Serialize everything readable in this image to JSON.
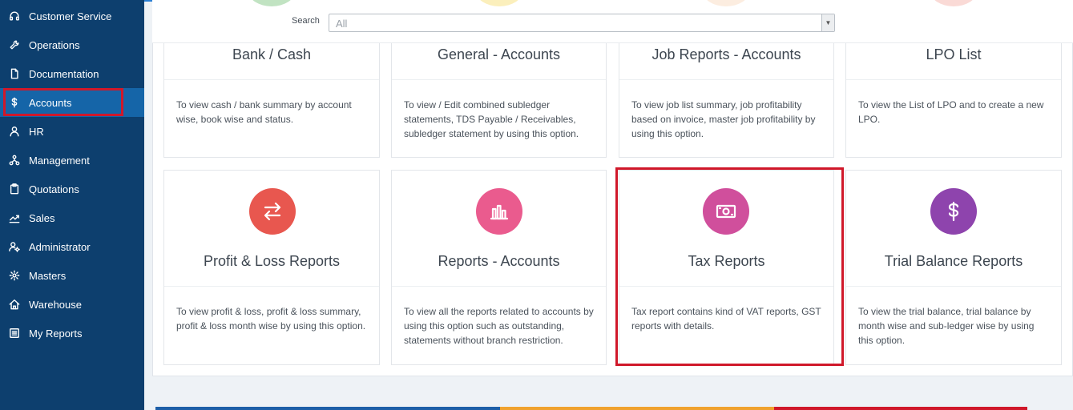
{
  "sidebar": {
    "items": [
      {
        "label": "Customer Service",
        "icon": "headset-icon"
      },
      {
        "label": "Operations",
        "icon": "wrench-icon"
      },
      {
        "label": "Documentation",
        "icon": "document-icon"
      },
      {
        "label": "Accounts",
        "icon": "dollar-icon",
        "active": true
      },
      {
        "label": "HR",
        "icon": "user-icon"
      },
      {
        "label": "Management",
        "icon": "hierarchy-icon"
      },
      {
        "label": "Quotations",
        "icon": "clipboard-icon"
      },
      {
        "label": "Sales",
        "icon": "chart-line-icon"
      },
      {
        "label": "Administrator",
        "icon": "user-gear-icon"
      },
      {
        "label": "Masters",
        "icon": "gear-icon"
      },
      {
        "label": "Warehouse",
        "icon": "home-icon"
      },
      {
        "label": "My Reports",
        "icon": "report-list-icon"
      }
    ]
  },
  "search": {
    "label": "Search",
    "selected": "All"
  },
  "cards": [
    {
      "title": "Bank / Cash",
      "desc": "To view cash / bank summary by account wise, book wise and status."
    },
    {
      "title": "General - Accounts",
      "desc": "To view / Edit combined subledger statements, TDS Payable / Receivables, subledger statement by using this option."
    },
    {
      "title": "Job Reports - Accounts",
      "desc": "To view job list summary, job profitability based on invoice, master job profitability by using this option."
    },
    {
      "title": "LPO List",
      "desc": "To view the List of LPO and to create a new LPO."
    },
    {
      "title": "Profit & Loss Reports",
      "desc": "To view profit & loss, profit & loss summary, profit & loss month wise by using this option.",
      "icon": "swap-arrows-icon",
      "color": "#e8574f"
    },
    {
      "title": "Reports - Accounts",
      "desc": "To view all the reports related to accounts by using this option such as outstanding, statements without branch restriction.",
      "icon": "bar-chart-icon",
      "color": "#ea5b8e"
    },
    {
      "title": "Tax Reports",
      "desc": "Tax report contains kind of VAT reports, GST reports with details.",
      "icon": "banknote-icon",
      "color": "#d04f9c"
    },
    {
      "title": "Trial Balance Reports",
      "desc": "To view the trial balance, trial balance by month wise and sub-ledger wise by using this option.",
      "icon": "dollar-icon",
      "color": "#8e44ad"
    }
  ],
  "colors": {
    "sidebar_bg": "#0d3f6e",
    "sidebar_active": "#1565a8",
    "highlight": "#d0182a"
  }
}
